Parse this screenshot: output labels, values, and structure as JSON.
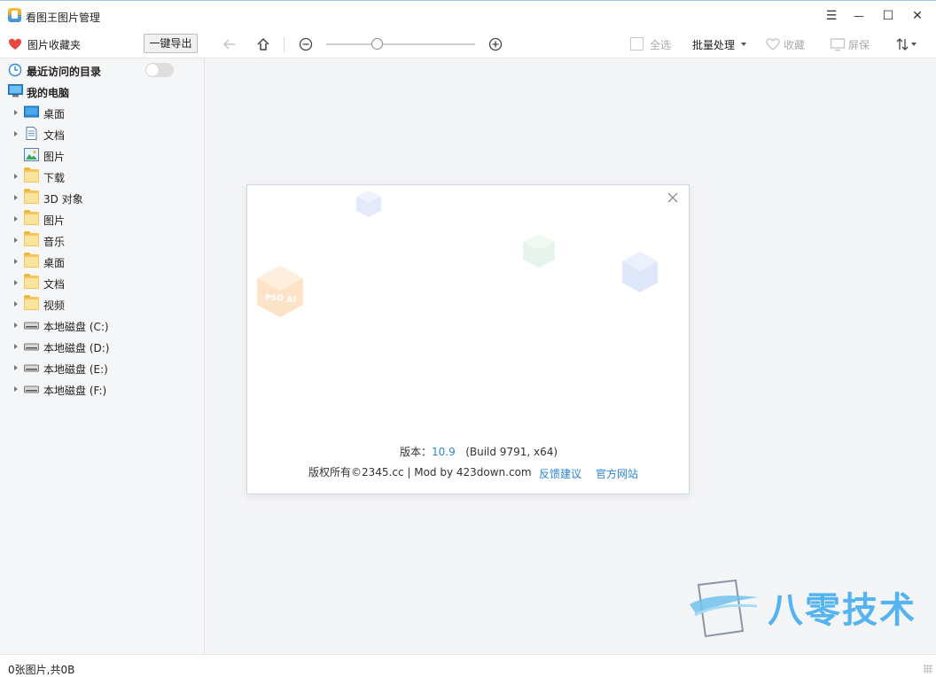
{
  "window": {
    "title": "看图王图片管理",
    "controls": {
      "menu": "☰",
      "minimize": "—",
      "maximize": "☐",
      "close": "✕"
    }
  },
  "toolbar": {
    "favorites_label": "图片收藏夹",
    "export_label": "一键导出",
    "select_all_label": "全选",
    "batch_label": "批量处理",
    "collect_label": "收藏",
    "screen_label": "屏保"
  },
  "sidebar": {
    "recent_label": "最近访问的目录",
    "recent_toggle_on": false,
    "computer_label": "我的电脑",
    "items": [
      {
        "label": "桌面",
        "icon": "desktop-icon",
        "expandable": true
      },
      {
        "label": "文档",
        "icon": "document-icon",
        "expandable": true
      },
      {
        "label": "图片",
        "icon": "image-icon",
        "expandable": false
      },
      {
        "label": "下载",
        "icon": "folder-icon",
        "expandable": true
      },
      {
        "label": "3D 对象",
        "icon": "folder-icon",
        "expandable": true
      },
      {
        "label": "图片",
        "icon": "folder-icon",
        "expandable": true
      },
      {
        "label": "音乐",
        "icon": "folder-icon",
        "expandable": true
      },
      {
        "label": "桌面",
        "icon": "folder-icon",
        "expandable": true
      },
      {
        "label": "文档",
        "icon": "folder-icon",
        "expandable": true
      },
      {
        "label": "视频",
        "icon": "folder-icon",
        "expandable": true
      },
      {
        "label": "本地磁盘 (C:)",
        "icon": "drive-icon",
        "expandable": true
      },
      {
        "label": "本地磁盘 (D:)",
        "icon": "drive-icon",
        "expandable": true
      },
      {
        "label": "本地磁盘 (E:)",
        "icon": "drive-icon",
        "expandable": true
      },
      {
        "label": "本地磁盘 (F:)",
        "icon": "drive-icon",
        "expandable": true
      }
    ]
  },
  "about": {
    "version_prefix": "版本：",
    "version": "10.9",
    "build": "(Build 9791, x64)",
    "copyright": "版权所有©2345.cc | Mod by 423down.com",
    "feedback_link": "反馈建议",
    "website_link": "官方网站"
  },
  "status": {
    "text": "0张图片,共0B"
  },
  "watermark": {
    "text": "八零技术"
  },
  "colors": {
    "accent": "#2a87d8",
    "heart": "#e8463f",
    "folder": "#f7c75c",
    "watermark": "#54b3f0"
  }
}
